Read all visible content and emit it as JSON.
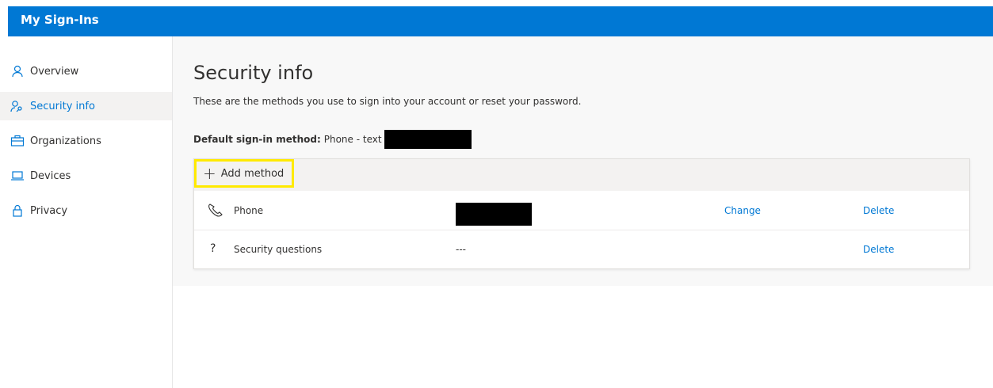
{
  "app": {
    "title": "My Sign-Ins"
  },
  "sidebar": {
    "items": [
      {
        "label": "Overview",
        "icon": "person-icon",
        "active": false
      },
      {
        "label": "Security info",
        "icon": "person-key-icon",
        "active": true
      },
      {
        "label": "Organizations",
        "icon": "briefcase-icon",
        "active": false
      },
      {
        "label": "Devices",
        "icon": "laptop-icon",
        "active": false
      },
      {
        "label": "Privacy",
        "icon": "lock-icon",
        "active": false
      }
    ]
  },
  "main": {
    "title": "Security info",
    "subtitle": "These are the methods you use to sign into your account or reset your password.",
    "default_method_label": "Default sign-in method:",
    "default_method_value": "Phone - text",
    "add_method_label": "Add method",
    "methods": [
      {
        "name": "Phone",
        "icon": "phone-icon",
        "detail": "",
        "change_label": "Change",
        "delete_label": "Delete"
      },
      {
        "name": "Security questions",
        "icon": "question-icon",
        "detail": "---",
        "change_label": "",
        "delete_label": "Delete"
      }
    ]
  },
  "colors": {
    "brand": "#0078d4",
    "highlight": "#ffea00",
    "link": "#0078d4"
  }
}
